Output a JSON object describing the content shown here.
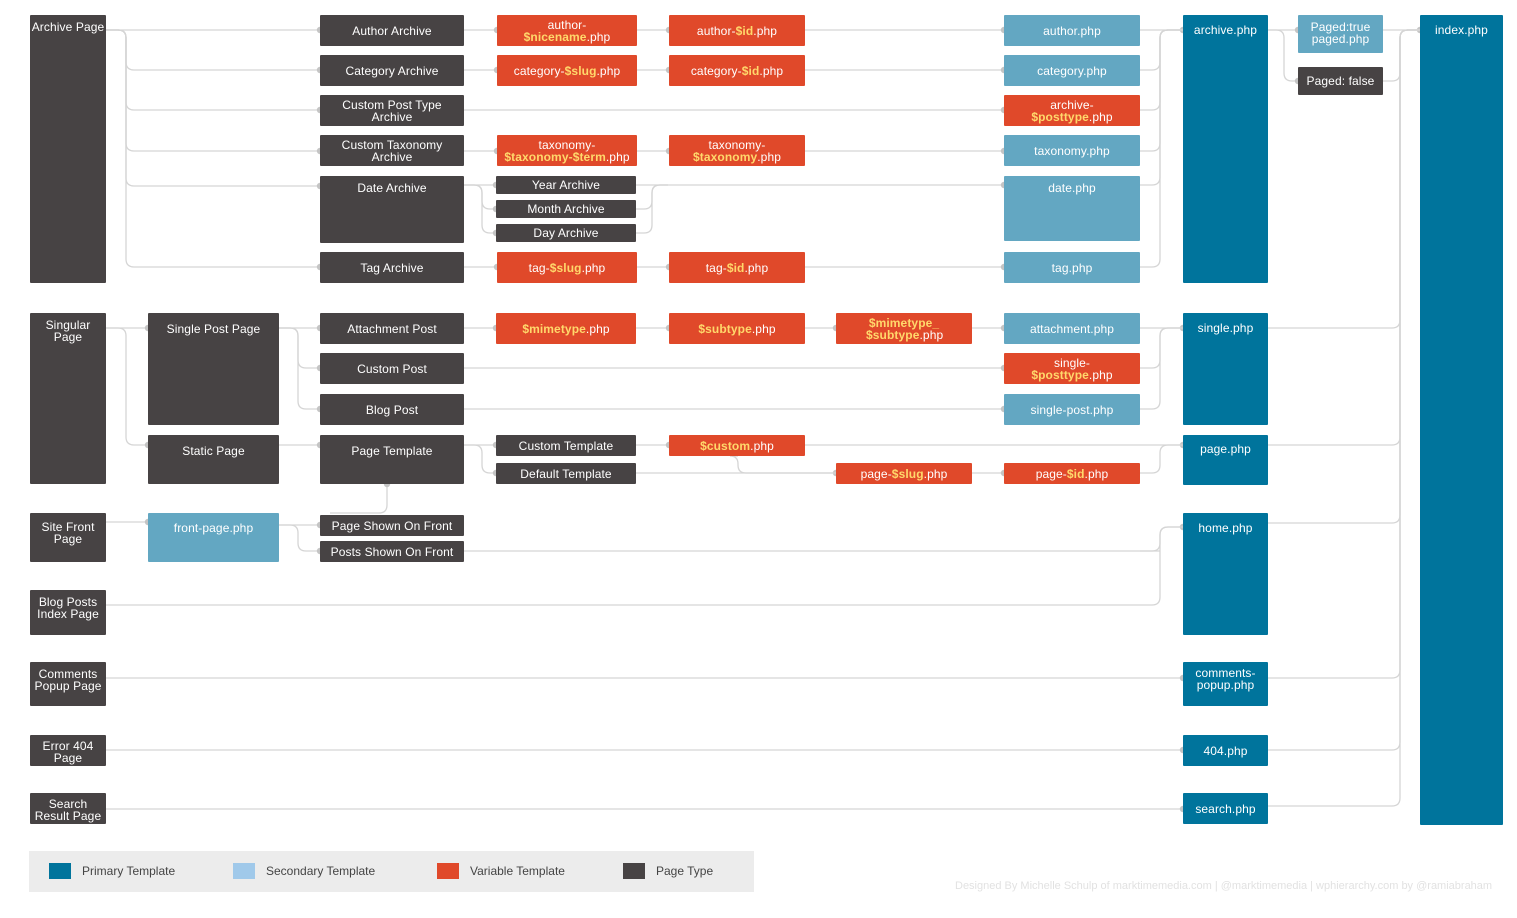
{
  "colors": {
    "page_type": "#474344",
    "secondary": "#63a7c2",
    "variable": "#e0492a",
    "primary": "#00749c",
    "variable_highlight": "#ffd86b",
    "connector": "#d5d5d5",
    "legend_bg": "#ececec"
  },
  "page_types": {
    "archive": "Archive Page",
    "singular": "Singular Page",
    "site_front": "Site Front Page",
    "blog_posts_index": "Blog Posts Index Page",
    "comments_popup": "Comments Popup Page",
    "error_404": "Error 404 Page",
    "search_result": "Search Result Page"
  },
  "archive": {
    "author": {
      "label": "Author Archive",
      "var1": [
        "author-",
        "$nicename",
        ".php"
      ],
      "var2": [
        "author-",
        "$id",
        ".php"
      ],
      "secondary": "author.php"
    },
    "category": {
      "label": "Category Archive",
      "var1": [
        "category-",
        "$slug",
        ".php"
      ],
      "var2": [
        "category-",
        "$id",
        ".php"
      ],
      "secondary": "category.php"
    },
    "custom_post_type": {
      "label": "Custom Post Type Archive",
      "var": [
        "archive-",
        "$posttype",
        ".php"
      ]
    },
    "taxonomy": {
      "label": "Custom Taxonomy Archive",
      "var1": [
        "taxonomy-",
        "$taxonomy-$term",
        ".php"
      ],
      "var2": [
        "taxonomy-",
        "$taxonomy",
        ".php"
      ],
      "secondary": "taxonomy.php"
    },
    "date": {
      "label": "Date Archive",
      "year": "Year Archive",
      "month": "Month Archive",
      "day": "Day Archive",
      "secondary": "date.php"
    },
    "tag": {
      "label": "Tag Archive",
      "var1": [
        "tag-",
        "$slug",
        ".php"
      ],
      "var2": [
        "tag-",
        "$id",
        ".php"
      ],
      "secondary": "tag.php"
    },
    "primary": "archive.php",
    "paged_true": "Paged:true paged.php",
    "paged_false": "Paged: false"
  },
  "singular": {
    "single_post_page": "Single Post Page",
    "attachment": {
      "label": "Attachment Post",
      "var1": [
        "",
        "$mimetype",
        ".php"
      ],
      "var2": [
        "",
        "$subtype",
        ".php"
      ],
      "var3": [
        "",
        "$mimetype_ $subtype",
        ".php"
      ],
      "secondary": "attachment.php"
    },
    "custom_post": {
      "label": "Custom Post",
      "var": [
        "single-",
        "$posttype",
        ".php"
      ]
    },
    "blog_post": {
      "label": "Blog Post",
      "secondary": "single-post.php"
    },
    "single_primary": "single.php",
    "static_page": "Static Page",
    "page_template": "Page Template",
    "custom_template": "Custom Template",
    "default_template": "Default Template",
    "custom_var": [
      "",
      "$custom",
      ".php"
    ],
    "page_slug": [
      "page-",
      "$slug",
      ".php"
    ],
    "page_id": [
      "page-",
      "$id",
      ".php"
    ],
    "page_primary": "page.php"
  },
  "front": {
    "front_page_php": "front-page.php",
    "page_shown": "Page Shown On Front",
    "posts_shown": "Posts Shown On Front",
    "home_primary": "home.php"
  },
  "others": {
    "comments_popup_primary": "comments-popup.php",
    "error_404_primary": "404.php",
    "search_primary": "search.php"
  },
  "index": "index.php",
  "legend": [
    {
      "label": "Primary Template",
      "color": "#00749c"
    },
    {
      "label": "Secondary Template",
      "color": "#a0c9ea"
    },
    {
      "label": "Variable Template",
      "color": "#e0492a"
    },
    {
      "label": "Page Type",
      "color": "#474344"
    }
  ],
  "credit": "Designed By Michelle Schulp of marktimemedia.com  |  @marktimemedia  | wphierarchy.com by @ramiabraham"
}
